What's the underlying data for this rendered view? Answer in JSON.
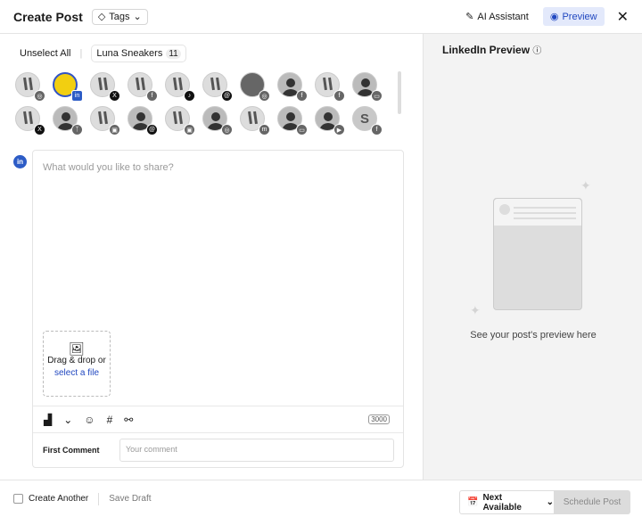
{
  "header": {
    "title": "Create Post",
    "tags_label": "Tags",
    "ai_label": "AI Assistant",
    "preview_label": "Preview"
  },
  "selector": {
    "unselect_all": "Unselect All",
    "group_name": "Luna Sneakers",
    "group_count": "11"
  },
  "accounts": [
    {
      "avatar": "photo",
      "network": "instagram",
      "glyph": "◎",
      "selected": false
    },
    {
      "avatar": "sel",
      "network": "linkedin",
      "glyph": "in",
      "selected": true
    },
    {
      "avatar": "photo",
      "network": "x",
      "glyph": "X",
      "selected": false
    },
    {
      "avatar": "photo",
      "network": "facebook",
      "glyph": "f",
      "selected": false
    },
    {
      "avatar": "photo",
      "network": "tiktok",
      "glyph": "♪",
      "selected": false
    },
    {
      "avatar": "photo",
      "network": "threads",
      "glyph": "@",
      "selected": false
    },
    {
      "avatar": "dark",
      "network": "instagram",
      "glyph": "◎",
      "selected": false
    },
    {
      "avatar": "person",
      "network": "facebook",
      "glyph": "f",
      "selected": false
    },
    {
      "avatar": "photo",
      "network": "facebook",
      "glyph": "f",
      "selected": false
    },
    {
      "avatar": "person",
      "network": "google-business",
      "glyph": "▭",
      "selected": false
    },
    {
      "avatar": "photo",
      "network": "x",
      "glyph": "X",
      "selected": false
    },
    {
      "avatar": "person",
      "network": "bluesky",
      "glyph": "ᛉ",
      "selected": false
    },
    {
      "avatar": "photo",
      "network": "save",
      "glyph": "▣",
      "selected": false
    },
    {
      "avatar": "person",
      "network": "threads",
      "glyph": "@",
      "selected": false
    },
    {
      "avatar": "photo",
      "network": "save",
      "glyph": "▣",
      "selected": false
    },
    {
      "avatar": "person",
      "network": "instagram",
      "glyph": "◎",
      "selected": false
    },
    {
      "avatar": "photo",
      "network": "mastodon",
      "glyph": "m",
      "selected": false
    },
    {
      "avatar": "person",
      "network": "google-business",
      "glyph": "▭",
      "selected": false
    },
    {
      "avatar": "person",
      "network": "youtube",
      "glyph": "▶",
      "selected": false
    },
    {
      "avatar": "letter",
      "letter": "S",
      "network": "facebook",
      "glyph": "f",
      "selected": false
    }
  ],
  "editor": {
    "network_badge": "in",
    "placeholder": "What would you like to share?",
    "drop_text": "Drag & drop or",
    "drop_link": "select a file",
    "char_limit": "3000",
    "first_comment_label": "First Comment",
    "comment_placeholder": "Your comment"
  },
  "preview": {
    "title": "LinkedIn Preview",
    "empty_text": "See your post's preview here"
  },
  "footer": {
    "create_another": "Create Another",
    "save_draft": "Save Draft",
    "next_available": "Next Available",
    "schedule": "Schedule Post"
  }
}
